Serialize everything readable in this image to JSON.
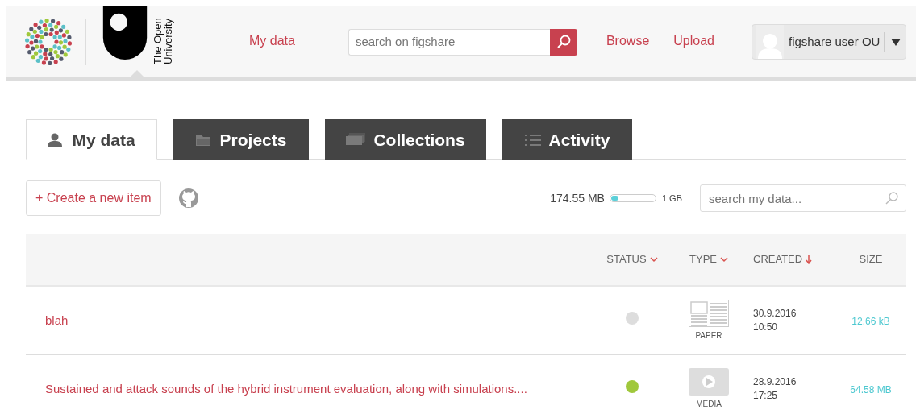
{
  "header": {
    "org_name": [
      "The Open",
      "University"
    ],
    "nav_before_search": [
      {
        "label": "My data",
        "selected": true
      }
    ],
    "search": {
      "placeholder": "search on figshare"
    },
    "nav_after_search": [
      {
        "label": "Browse",
        "selected": false
      },
      {
        "label": "Upload",
        "selected": false
      }
    ],
    "user": {
      "name": "figshare user OU"
    }
  },
  "tabs": [
    {
      "label": "My data",
      "kind": "person",
      "selected": true
    },
    {
      "label": "Projects",
      "kind": "folder",
      "selected": false
    },
    {
      "label": "Collections",
      "kind": "stack",
      "selected": false
    },
    {
      "label": "Activity",
      "kind": "list",
      "selected": false
    }
  ],
  "toolbar": {
    "create_button": "+ Create a new item",
    "storage": {
      "used": "174.55 MB",
      "level": 0.17,
      "total": "1 GB"
    },
    "search": {
      "placeholder": "search my data..."
    }
  },
  "table": {
    "columns": [
      {
        "label": "STATUS",
        "kind": "filter"
      },
      {
        "label": "TYPE",
        "kind": "filter"
      },
      {
        "label": "CREATED",
        "kind": "sort"
      },
      {
        "label": "SIZE",
        "kind": "plain"
      }
    ],
    "rows": [
      {
        "title": "blah",
        "color": "#dddddd",
        "type": "PAPER",
        "kind": "paper",
        "date": "30.9.2016",
        "time": "10:50",
        "size": "12.66 kB"
      },
      {
        "title": "Sustained and attack sounds of the hybrid instrument evaluation, along with simulations....",
        "color": "#a0c83c",
        "type": "MEDIA",
        "kind": "media",
        "date": "28.9.2016",
        "time": "17:25",
        "size": "64.58 MB"
      }
    ]
  }
}
